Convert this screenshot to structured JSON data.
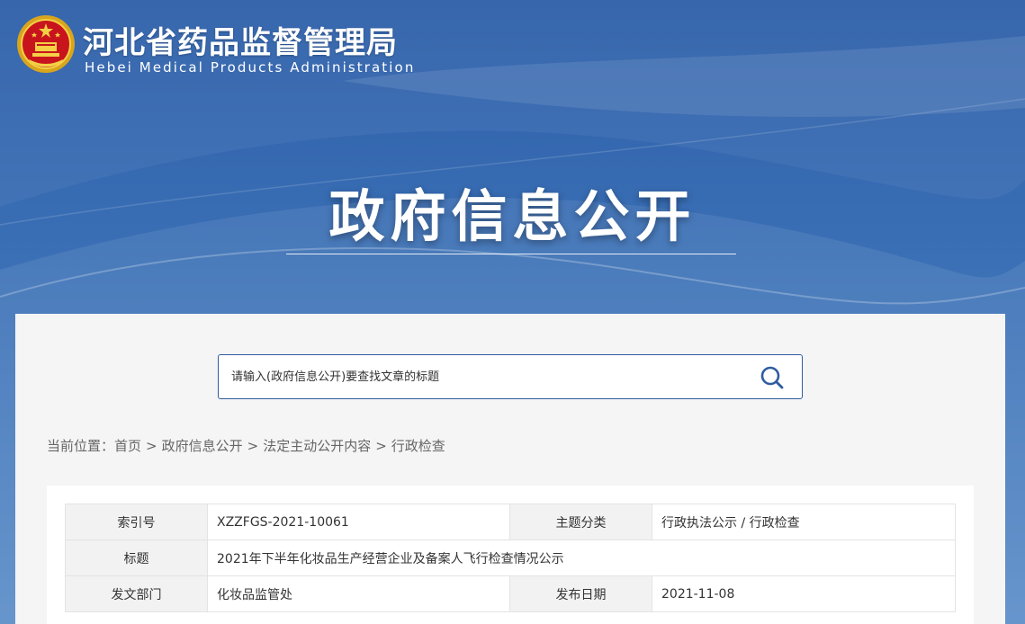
{
  "header": {
    "site_name_cn": "河北省药品监督管理局",
    "site_name_en": "Hebei Medical Products Administration",
    "hero_title": "政府信息公开"
  },
  "search": {
    "placeholder": "请输入(政府信息公开)要查找文章的标题",
    "icon": "search-icon"
  },
  "breadcrumb": {
    "prefix": "当前位置：",
    "items": [
      "首页",
      "政府信息公开",
      "法定主动公开内容",
      "行政检查"
    ],
    "separator": ">"
  },
  "meta_table": {
    "rows": [
      {
        "label1": "索引号",
        "value1": "XZZFGS-2021-10061",
        "label2": "主题分类",
        "value2": "行政执法公示 / 行政检查"
      },
      {
        "label1": "标题",
        "value1": "2021年下半年化妆品生产经营企业及备案人飞行检查情况公示"
      },
      {
        "label1": "发文部门",
        "value1": "化妆品监管处",
        "label2": "发布日期",
        "value2": "2021-11-08"
      }
    ]
  },
  "colors": {
    "banner_blue": "#2d5ea8",
    "accent": "#2f5c9f",
    "content_bg": "#f5f5f5"
  }
}
